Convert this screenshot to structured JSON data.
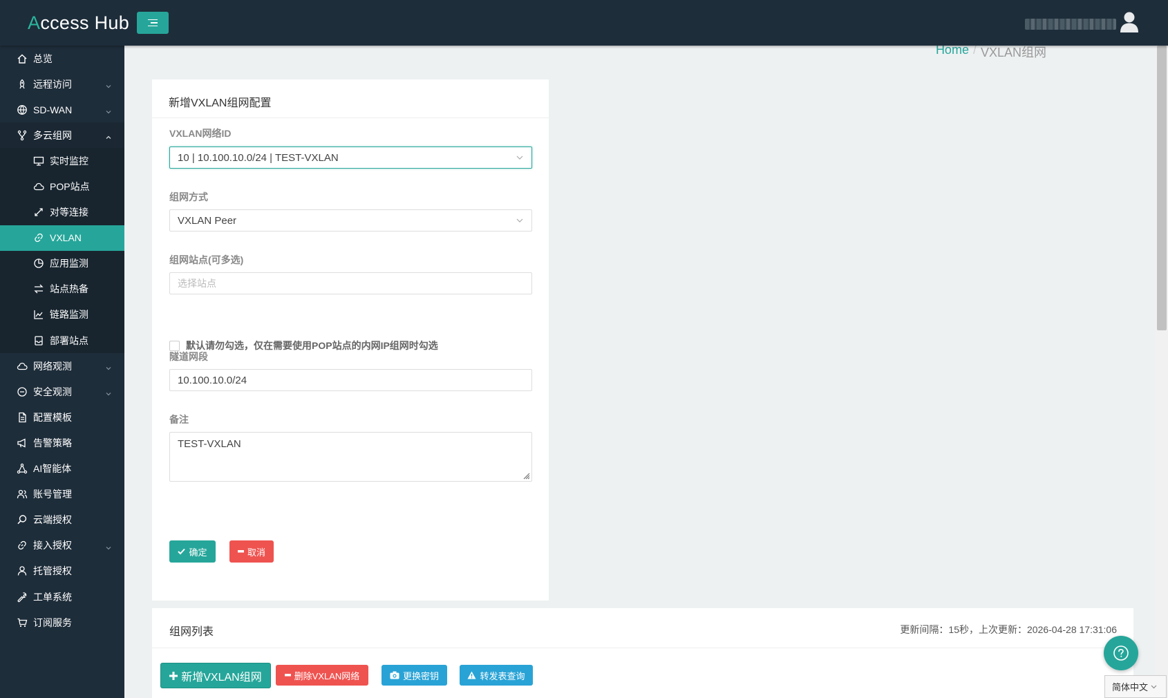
{
  "header": {
    "logo_prefix": "A",
    "logo_rest": "ccess Hub",
    "menu_toggle_icon": "menu-icon",
    "user_icon": "user-icon"
  },
  "sidebar": {
    "items": [
      {
        "label": "总览",
        "icon": "home-icon"
      },
      {
        "label": "远程访问",
        "icon": "rocket-icon",
        "expandable": true
      },
      {
        "label": "SD-WAN",
        "icon": "globe-icon",
        "expandable": true
      },
      {
        "label": "多云组网",
        "icon": "fork-icon",
        "expandable": true,
        "open": true
      },
      {
        "label": "实时监控",
        "icon": "monitor-icon",
        "sub": true
      },
      {
        "label": "POP站点",
        "icon": "cloud-icon",
        "sub": true
      },
      {
        "label": "对等连接",
        "icon": "arrows-diagonal-icon",
        "sub": true
      },
      {
        "label": "VXLAN",
        "icon": "link-icon",
        "sub": true,
        "active": true
      },
      {
        "label": "应用监测",
        "icon": "pie-chart-icon",
        "sub": true
      },
      {
        "label": "站点热备",
        "icon": "swap-icon",
        "sub": true
      },
      {
        "label": "链路监测",
        "icon": "line-chart-icon",
        "sub": true
      },
      {
        "label": "部署站点",
        "icon": "archive-icon",
        "sub": true
      },
      {
        "label": "网络观测",
        "icon": "cloud-icon",
        "expandable": true
      },
      {
        "label": "安全观测",
        "icon": "minus-circle-icon",
        "expandable": true
      },
      {
        "label": "配置模板",
        "icon": "file-icon"
      },
      {
        "label": "告警策略",
        "icon": "megaphone-icon"
      },
      {
        "label": "AI智能体",
        "icon": "network-icon"
      },
      {
        "label": "账号管理",
        "icon": "users-icon"
      },
      {
        "label": "云端授权",
        "icon": "search-icon"
      },
      {
        "label": "接入授权",
        "icon": "link-icon",
        "expandable": true
      },
      {
        "label": "托管授权",
        "icon": "user-icon"
      },
      {
        "label": "工单系统",
        "icon": "wrench-icon"
      },
      {
        "label": "订阅服务",
        "icon": "cart-icon"
      }
    ]
  },
  "breadcrumb": {
    "home": "Home",
    "sep": "/",
    "current": "VXLAN组网"
  },
  "form": {
    "title": "新增VXLAN组网配置",
    "vxlan_id_label": "VXLAN网络ID",
    "vxlan_id_value": "10 | 10.100.10.0/24 | TEST-VXLAN",
    "mode_label": "组网方式",
    "mode_value": "VXLAN Peer",
    "sites_label": "组网站点(可多选)",
    "sites_placeholder": "选择站点",
    "checkbox_label": "默认请勿勾选，仅在需要使用POP站点的内网IP组网时勾选",
    "tunnel_label": "隧道网段",
    "tunnel_value": "10.100.10.0/24",
    "remark_label": "备注",
    "remark_value": "TEST-VXLAN",
    "ok_label": "确定",
    "cancel_label": "取消"
  },
  "list": {
    "title": "组网列表",
    "status": "更新间隔：15秒，上次更新：2026-04-28 17:31:06",
    "add_label": "新增VXLAN组网",
    "delete_label": "删除VXLAN网络",
    "rekey_label": "更换密钥",
    "forward_label": "转发表查询"
  },
  "language": {
    "selected": "简体中文"
  },
  "colors": {
    "accent": "#26a69a",
    "danger": "#ef5350",
    "info": "#29a3d6",
    "sidebar": "#1e2d3a"
  }
}
